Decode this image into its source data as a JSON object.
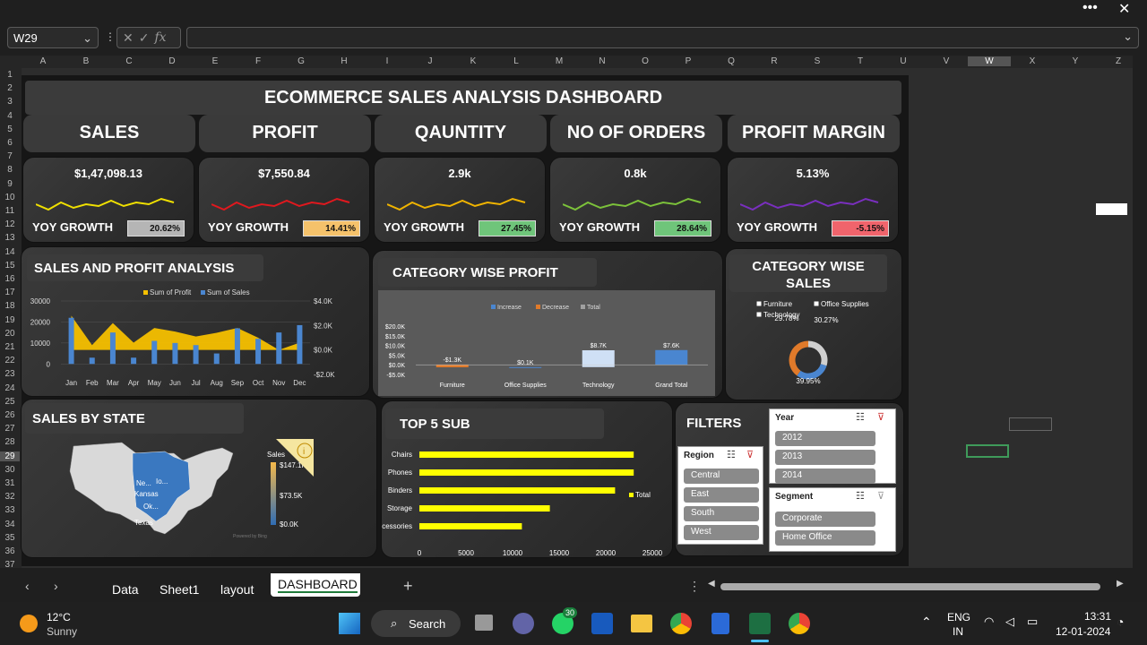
{
  "formula_bar": {
    "name_box": "W29",
    "fx": "fx"
  },
  "columns": [
    "A",
    "B",
    "C",
    "D",
    "E",
    "F",
    "G",
    "H",
    "I",
    "J",
    "K",
    "L",
    "M",
    "N",
    "O",
    "P",
    "Q",
    "R",
    "S",
    "T",
    "U",
    "V",
    "W",
    "X",
    "Y",
    "Z"
  ],
  "rows": [
    "1",
    "2",
    "3",
    "4",
    "5",
    "6",
    "7",
    "8",
    "9",
    "10",
    "11",
    "12",
    "13",
    "14",
    "15",
    "16",
    "17",
    "18",
    "19",
    "20",
    "21",
    "22",
    "23",
    "24",
    "25",
    "26",
    "27",
    "28",
    "29",
    "30",
    "31",
    "32",
    "33",
    "34",
    "35",
    "36",
    "37"
  ],
  "dashboard": {
    "title": "ECOMMERCE SALES ANALYSIS DASHBOARD",
    "kpis": [
      {
        "label": "SALES",
        "value": "$1,47,098.13",
        "yoy_label": "YOY GROWTH",
        "yoy": "20.62%",
        "color": "#f0e000",
        "badge": "#b5b5b5"
      },
      {
        "label": "PROFIT",
        "value": "$7,550.84",
        "yoy_label": "YOY GROWTH",
        "yoy": "14.41%",
        "color": "#e0181e",
        "badge": "#f5c26b"
      },
      {
        "label": "QAUNTITY",
        "value": "2.9k",
        "yoy_label": "YOY GROWTH",
        "yoy": "27.45%",
        "color": "#f0b400",
        "badge": "#6fc57a"
      },
      {
        "label": "NO OF ORDERS",
        "value": "0.8k",
        "yoy_label": "YOY GROWTH",
        "yoy": "28.64%",
        "color": "#7cc23a",
        "badge": "#6fc57a"
      },
      {
        "label": "PROFIT MARGIN",
        "value": "5.13%",
        "yoy_label": "YOY GROWTH",
        "yoy": "-5.15%",
        "color": "#7a2fbf",
        "badge": "#f0646c"
      }
    ],
    "sp_title": "SALES AND PROFIT ANALYSIS",
    "cwp_title": "CATEGORY WISE PROFIT",
    "cws_title": "CATEGORY WISE SALES",
    "state_title": "SALES BY STATE",
    "top5_title": "TOP 5 SUB",
    "filters_title": "FILTERS"
  },
  "chart_data": [
    {
      "type": "bar",
      "name": "sales_profit",
      "categories": [
        "Jan",
        "Feb",
        "Mar",
        "Apr",
        "May",
        "Jun",
        "Jul",
        "Aug",
        "Sep",
        "Oct",
        "Nov",
        "Dec"
      ],
      "series": [
        {
          "name": "Sum of Profit",
          "type": "area",
          "axis": "right",
          "values": [
            2800,
            400,
            2200,
            600,
            1800,
            1500,
            1100,
            1400,
            1800,
            1000,
            0,
            600
          ],
          "color": "#f5c000"
        },
        {
          "name": "Sum of Sales",
          "type": "bar",
          "axis": "left",
          "values": [
            22000,
            3000,
            15000,
            3000,
            11000,
            10000,
            9000,
            5000,
            17000,
            12000,
            15000,
            18500
          ],
          "color": "#4a86d0"
        }
      ],
      "y_left_ticks": [
        "30000",
        "20000",
        "10000",
        "0"
      ],
      "y_right_ticks": [
        "$4.0K",
        "$2.0K",
        "$0.0K",
        "-$2.0K"
      ],
      "ylim_left": [
        -5000,
        30000
      ],
      "ylim_right": [
        -2000,
        4000
      ]
    },
    {
      "type": "bar",
      "name": "category_profit_waterfall",
      "legend": [
        "Increase",
        "Decrease",
        "Total"
      ],
      "categories": [
        "Furniture",
        "Office Supplies",
        "Technology",
        "Grand Total"
      ],
      "values": [
        -1.3,
        0.1,
        8.7,
        7.6
      ],
      "labels": [
        "-$1.3K",
        "$0.1K",
        "$8.7K",
        "$7.6K"
      ],
      "y_ticks": [
        "$20.0K",
        "$15.0K",
        "$10.0K",
        "$5.0K",
        "$0.0K",
        "-$5.0K"
      ],
      "ylim": [
        -5,
        20
      ]
    },
    {
      "type": "pie",
      "name": "category_sales",
      "legend": [
        "Furniture",
        "Office Supplies",
        "Technology"
      ],
      "labels": [
        "29.78%",
        "30.27%",
        "39.95%"
      ],
      "values": [
        29.78,
        30.27,
        39.95
      ]
    },
    {
      "type": "bar",
      "name": "top5_sub",
      "categories": [
        "Chairs",
        "Phones",
        "Binders",
        "Storage",
        "Accessories"
      ],
      "values": [
        23000,
        23000,
        21000,
        14000,
        11000
      ],
      "series_name": "Total",
      "x_ticks": [
        "0",
        "5000",
        "10000",
        "15000",
        "20000",
        "25000"
      ],
      "xlim": [
        0,
        25000
      ],
      "color": "#ffff00"
    }
  ],
  "map": {
    "legend_title": "Sales",
    "legend_ticks": [
      "$147.1K",
      "$73.5K",
      "$0.0K"
    ],
    "state_labels": [
      "Ne...",
      "Io...",
      "Kansas",
      "Ok...",
      "Texas"
    ],
    "credit": "Powered by Bing"
  },
  "slicers": {
    "year": {
      "title": "Year",
      "items": [
        "2012",
        "2013",
        "2014"
      ]
    },
    "region": {
      "title": "Region",
      "items": [
        "Central",
        "East",
        "South",
        "West"
      ]
    },
    "segment": {
      "title": "Segment",
      "items": [
        "Corporate",
        "Home Office"
      ]
    }
  },
  "sheets": [
    "Data",
    "Sheet1",
    "layout",
    "DASHBOARD"
  ],
  "active_sheet": "DASHBOARD",
  "taskbar": {
    "weather_temp": "12°C",
    "weather_desc": "Sunny",
    "search": "Search",
    "badge_count": "30",
    "lang1": "ENG",
    "lang2": "IN",
    "time": "13:31",
    "date": "12-01-2024"
  }
}
